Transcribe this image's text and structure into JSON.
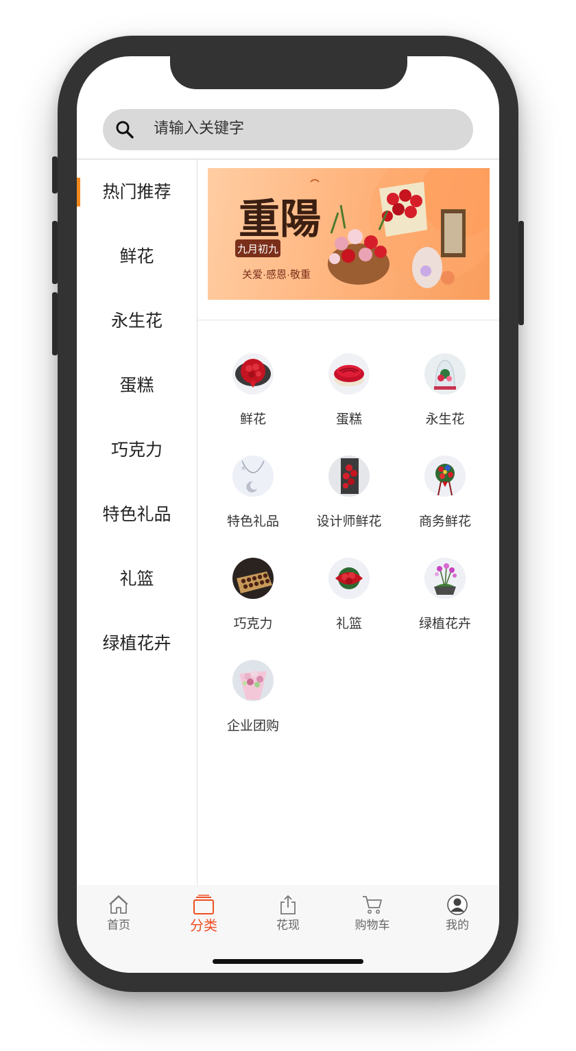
{
  "search": {
    "placeholder": "请输入关键字"
  },
  "sidebar": {
    "items": [
      {
        "label": "热门推荐",
        "active": true
      },
      {
        "label": "鲜花"
      },
      {
        "label": "永生花"
      },
      {
        "label": "蛋糕"
      },
      {
        "label": "巧克力"
      },
      {
        "label": "特色礼品"
      },
      {
        "label": "礼篮"
      },
      {
        "label": "绿植花卉"
      }
    ]
  },
  "banner": {
    "title": "重陽",
    "tag": "九月初九",
    "slogan": "关爱·感恩·敬重"
  },
  "categories": [
    {
      "label": "鲜花",
      "icon": "rose-bouquet-icon"
    },
    {
      "label": "蛋糕",
      "icon": "cake-icon"
    },
    {
      "label": "永生花",
      "icon": "preserved-flower-icon"
    },
    {
      "label": "特色礼品",
      "icon": "necklace-icon"
    },
    {
      "label": "设计师鲜花",
      "icon": "flower-box-icon"
    },
    {
      "label": "商务鲜花",
      "icon": "flower-basket-stand-icon"
    },
    {
      "label": "巧克力",
      "icon": "chocolate-box-icon"
    },
    {
      "label": "礼篮",
      "icon": "gift-basket-icon"
    },
    {
      "label": "绿植花卉",
      "icon": "orchid-pot-icon"
    },
    {
      "label": "企业团购",
      "icon": "pink-bouquet-icon"
    }
  ],
  "tabbar": {
    "items": [
      {
        "label": "首页",
        "icon": "home-icon"
      },
      {
        "label": "分类",
        "icon": "category-icon",
        "active": true
      },
      {
        "label": "花现",
        "icon": "share-icon"
      },
      {
        "label": "购物车",
        "icon": "cart-icon"
      },
      {
        "label": "我的",
        "icon": "user-icon"
      }
    ]
  },
  "colors": {
    "accent": "#f04e23",
    "sidebar_indicator": "#f58a1f",
    "phone_frame": "#333333",
    "search_bg": "#d9d9d9"
  }
}
